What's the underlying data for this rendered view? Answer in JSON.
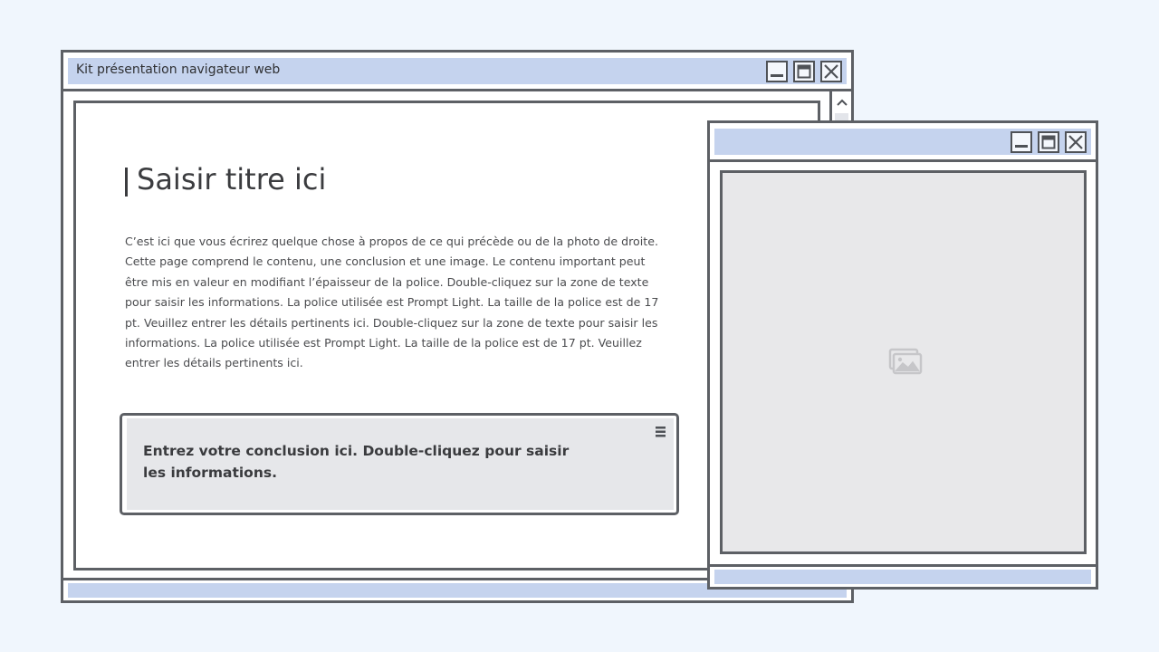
{
  "window_main": {
    "title": "Kit présentation navigateur web",
    "controls": {
      "minimize": "minimize-icon",
      "maximize": "maximize-icon",
      "close": "close-icon"
    }
  },
  "slide": {
    "heading": "Saisir titre ici",
    "body": "C’est ici que vous écrirez quelque chose à propos de ce qui précède ou de la photo de droite. Cette page comprend le contenu, une conclusion et une image. Le contenu important peut être mis en valeur en modifiant l’épaisseur de la police. Double-cliquez sur la zone de texte pour saisir les informations. La police utilisée est Prompt Light. La taille de la police est de 17 pt. Veuillez entrer les détails pertinents ici. Double-cliquez sur la zone de texte pour saisir les informations. La police utilisée est Prompt Light. La taille de la police est de 17 pt. Veuillez entrer les détails pertinents ici.",
    "conclusion": "Entrez votre conclusion ici. Double-cliquez pour saisir les informations.",
    "conclusion_menu_icon": "hamburger-menu-icon"
  },
  "window_image": {
    "controls": {
      "minimize": "minimize-icon",
      "maximize": "maximize-icon",
      "close": "close-icon"
    },
    "image_icon": "image-placeholder-icon"
  },
  "colors": {
    "background": "#f0f6fd",
    "titlebar": "#c5d3ee",
    "border": "#5d6065",
    "placeholder": "#e8e8ea",
    "conclusion_fill": "#e6e7ea"
  }
}
